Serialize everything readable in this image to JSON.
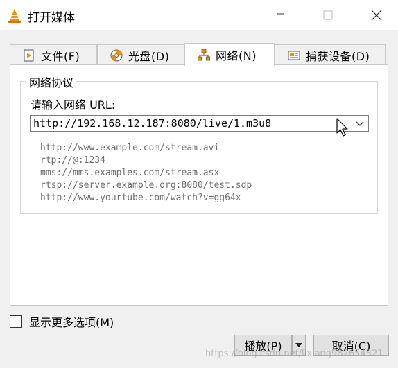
{
  "window": {
    "title": "打开媒体",
    "icon": "vlc-cone-icon",
    "minimize_symbol": "—",
    "maximize_symbol": "□",
    "close_symbol": "✕"
  },
  "tabs": [
    {
      "label": "文件(F)",
      "icon": "file-play-icon"
    },
    {
      "label": "光盘(D)",
      "icon": "disc-icon"
    },
    {
      "label": "网络(N)",
      "icon": "network-icon",
      "active": true
    },
    {
      "label": "捕获设备(D)",
      "icon": "capture-device-icon"
    }
  ],
  "network": {
    "group_title": "网络协议",
    "url_label": "请输入网络 URL:",
    "url_value": "http://192.168.12.187:8080/live/1.m3u8",
    "examples": [
      "http://www.example.com/stream.avi",
      "rtp://@:1234",
      "mms://mms.examples.com/stream.asx",
      "rtsp://server.example.org:8080/test.sdp",
      "http://www.yourtube.com/watch?v=gg64x"
    ]
  },
  "options": {
    "show_more_label": "显示更多选项(M)",
    "show_more_checked": false
  },
  "buttons": {
    "play": "播放(P)",
    "cancel": "取消(C)"
  },
  "watermark": "https://blog.csdn.net/lixiang987654321"
}
